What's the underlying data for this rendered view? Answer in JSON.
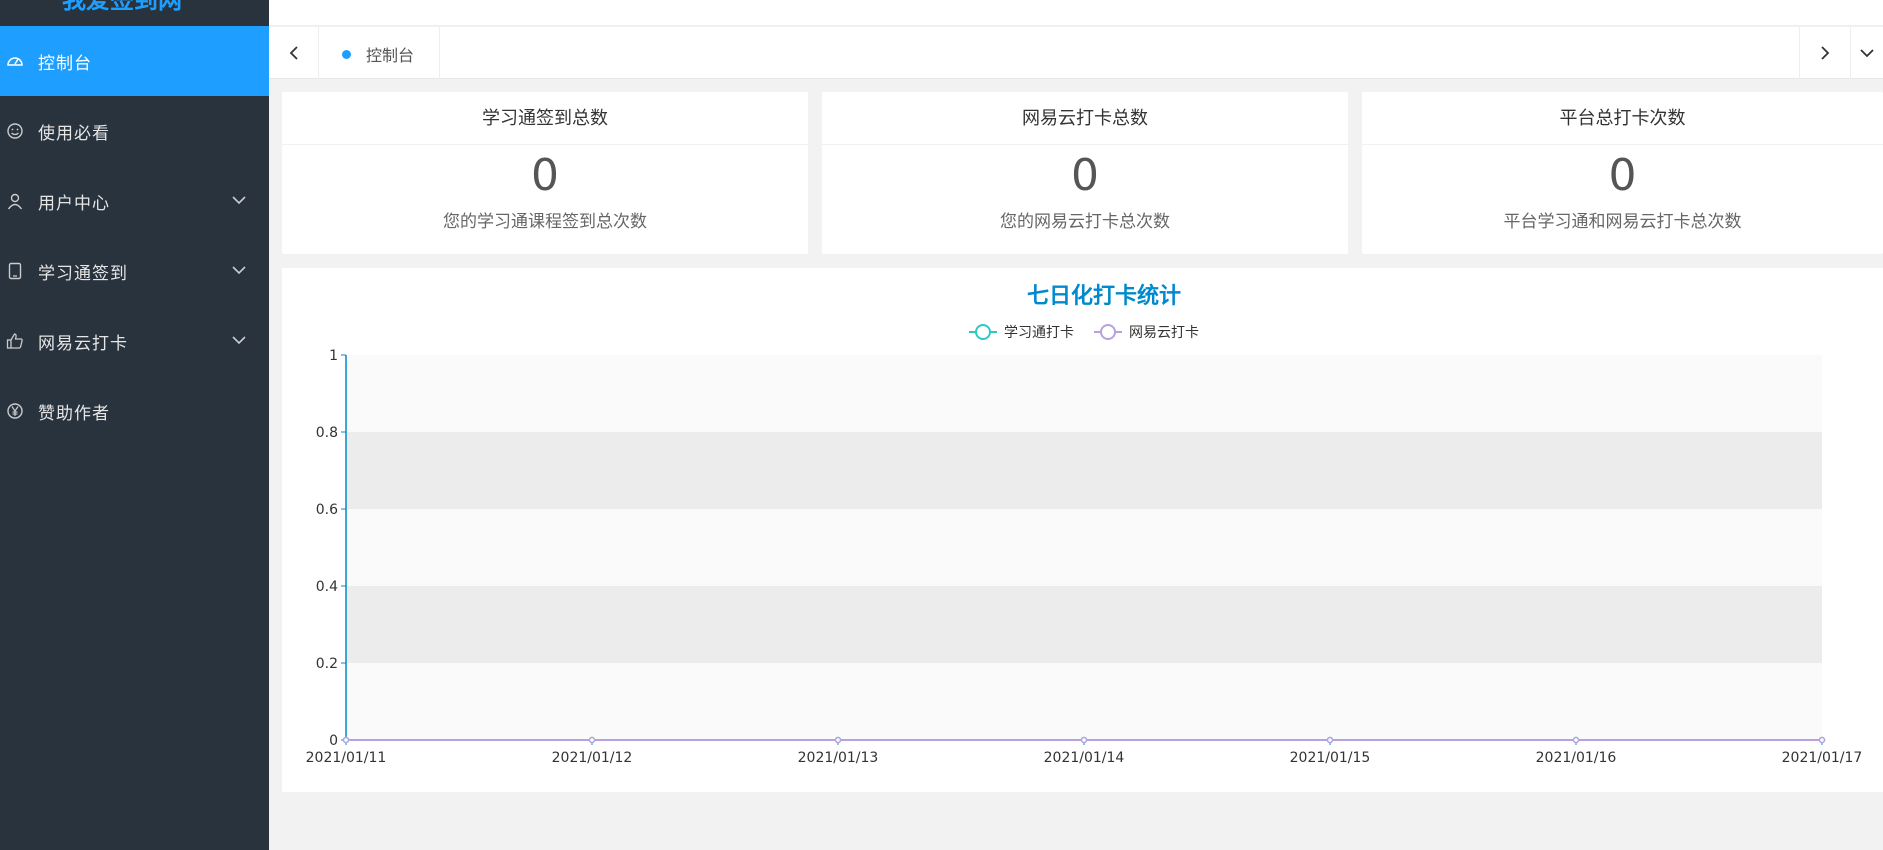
{
  "sidebar": {
    "logo": "我爱签到网",
    "items": [
      {
        "label": "控制台",
        "icon": "dashboard-icon",
        "active": true,
        "has_children": false
      },
      {
        "label": "使用必看",
        "icon": "smile-icon",
        "active": false,
        "has_children": false
      },
      {
        "label": "用户中心",
        "icon": "user-icon",
        "active": false,
        "has_children": true
      },
      {
        "label": "学习通签到",
        "icon": "phone-icon",
        "active": false,
        "has_children": true
      },
      {
        "label": "网易云打卡",
        "icon": "thumbs-up-icon",
        "active": false,
        "has_children": true
      },
      {
        "label": "赞助作者",
        "icon": "yen-icon",
        "active": false,
        "has_children": false
      }
    ]
  },
  "tabs": {
    "current": "控制台"
  },
  "cards": [
    {
      "title": "学习通签到总数",
      "value": "0",
      "desc": "您的学习通课程签到总次数"
    },
    {
      "title": "网易云打卡总数",
      "value": "0",
      "desc": "您的网易云打卡总次数"
    },
    {
      "title": "平台总打卡次数",
      "value": "0",
      "desc": "平台学习通和网易云打卡总次数"
    }
  ],
  "colors": {
    "accent": "#1e9fff",
    "sidebar_bg": "#28333e",
    "series1": "#2ec7c9",
    "series2": "#b6a2de"
  },
  "chart_data": {
    "type": "line",
    "title": "七日化打卡统计",
    "x": [
      "2021/01/11",
      "2021/01/12",
      "2021/01/13",
      "2021/01/14",
      "2021/01/15",
      "2021/01/16",
      "2021/01/17"
    ],
    "series": [
      {
        "name": "学习通打卡",
        "values": [
          0,
          0,
          0,
          0,
          0,
          0,
          0
        ],
        "color": "#2ec7c9"
      },
      {
        "name": "网易云打卡",
        "values": [
          0,
          0,
          0,
          0,
          0,
          0,
          0
        ],
        "color": "#b6a2de"
      }
    ],
    "ylim": [
      0,
      1
    ],
    "yticks": [
      "0",
      "0.2",
      "0.4",
      "0.6",
      "0.8",
      "1"
    ],
    "legend": "top-center",
    "grid": true
  }
}
